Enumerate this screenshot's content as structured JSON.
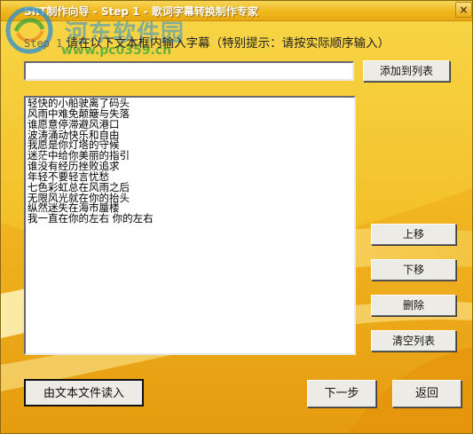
{
  "window": {
    "title": "SRT制作向导 - Step 1 - 歌词字幕转换制作专家",
    "close_glyph": "×"
  },
  "watermark": {
    "name": "河东软件园",
    "url": "www.pc0359.cn"
  },
  "instruction": {
    "step": "Step 1",
    "text": "请在以下文本框内输入字幕（特别提示：请按实际顺序输入）"
  },
  "subtitle_input": {
    "value": ""
  },
  "buttons": {
    "add_to_list": "添加到列表",
    "move_up": "上移",
    "move_down": "下移",
    "delete": "删除",
    "clear_list": "清空列表",
    "read_from_file": "由文本文件读入",
    "next": "下一步",
    "back": "返回"
  },
  "subtitle_list": [
    "轻快的小船驶离了码头",
    "风雨中难免颠簸与失落",
    "谁愿意停滞避风港口",
    "波涛涌动快乐和自由",
    "我愿是你灯塔的守候",
    "迷茫中给你美丽的指引",
    "谁没有经历挫败追求",
    "年轻不要轻言忧愁",
    "七色彩虹总在风雨之后",
    "无限风光就在你的抬头",
    "纵然迷失在海市蜃楼",
    "我一直在你的左右  你的左右"
  ],
  "colors": {
    "background_yellow": "#f5c52b",
    "titlebar": "#f0b71c",
    "watermark_blue": "#2a8fd0",
    "watermark_green": "#3aa43a"
  },
  "icons": {
    "watermark_logo": "swirl-logo-icon",
    "close": "close-icon"
  }
}
